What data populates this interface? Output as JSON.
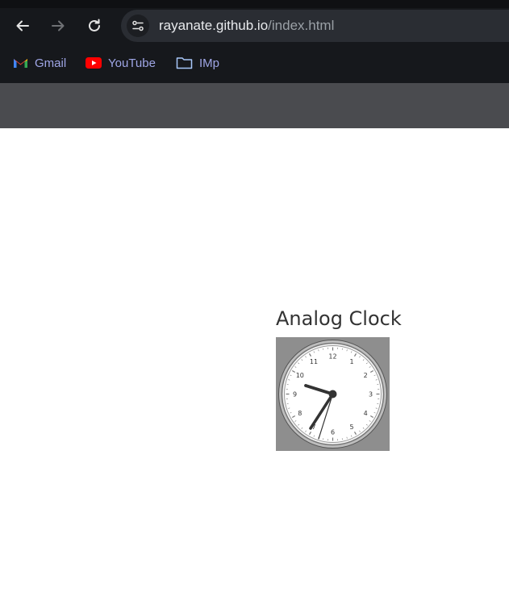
{
  "toolbar": {
    "back_icon": "back-arrow-icon",
    "forward_icon": "forward-arrow-icon",
    "reload_icon": "reload-icon",
    "site_info_icon": "tune-icon"
  },
  "address_bar": {
    "host": "rayanate.github.io",
    "path": "/index.html"
  },
  "bookmarks": [
    {
      "label": "Gmail",
      "icon": "gmail-icon"
    },
    {
      "label": "YouTube",
      "icon": "youtube-icon"
    },
    {
      "label": "IMp",
      "icon": "folder-icon"
    }
  ],
  "page": {
    "title": "Analog Clock",
    "clock": {
      "numerals": [
        "12",
        "1",
        "2",
        "3",
        "4",
        "5",
        "6",
        "7",
        "8",
        "9",
        "10",
        "11"
      ],
      "hour_hand_direction": "toward 9:30",
      "minute_hand_direction": "toward 35",
      "face_color": "#ffffff",
      "background_color": "#8e8e8e"
    }
  },
  "colors": {
    "browser_dark": "#16181c",
    "omnibox": "#2a2d33",
    "page_bar": "#4a4b4f"
  }
}
